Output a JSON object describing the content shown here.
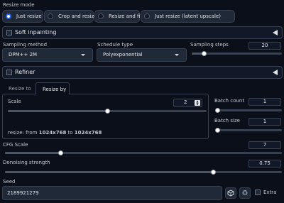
{
  "resize_mode": {
    "label": "Resize mode",
    "options": [
      "Just resize",
      "Crop and resize",
      "Resize and fill",
      "Just resize (latent upscale)"
    ],
    "selected": "Just resize"
  },
  "soft_inpainting": {
    "label": "Soft inpainting",
    "checked": false
  },
  "sampling_method": {
    "label": "Sampling method",
    "value": "DPM++ 2M"
  },
  "schedule_type": {
    "label": "Schedule type",
    "value": "Polyexponential"
  },
  "sampling_steps": {
    "label": "Sampling steps",
    "value": "20",
    "fraction": 0.13
  },
  "refiner": {
    "label": "Refiner",
    "checked": false
  },
  "resize_tabs": {
    "tabs": [
      "Resize to",
      "Resize by"
    ],
    "active": "Resize by"
  },
  "scale": {
    "label": "Scale",
    "value": "2",
    "fraction": 0.5,
    "info_prefix": "resize: from ",
    "from": "1024x768",
    "info_mid": " to ",
    "to": "1024x768"
  },
  "batch_count": {
    "label": "Batch count",
    "value": "1",
    "fraction": 0.0
  },
  "batch_size": {
    "label": "Batch size",
    "value": "1",
    "fraction": 0.0
  },
  "cfg_scale": {
    "label": "CFG Scale",
    "value": "7",
    "fraction": 0.2
  },
  "denoising_strength": {
    "label": "Denoising strength",
    "value": "0.75",
    "fraction": 0.75
  },
  "seed": {
    "label": "Seed",
    "value": "2189921279",
    "extra_label": "Extra"
  },
  "icons": {
    "dice": "dice-icon",
    "recycle": "recycle-icon"
  },
  "colors": {
    "accent": "#2563eb",
    "background": "#0b0f19",
    "surface": "#1f2937",
    "border": "#374151"
  }
}
